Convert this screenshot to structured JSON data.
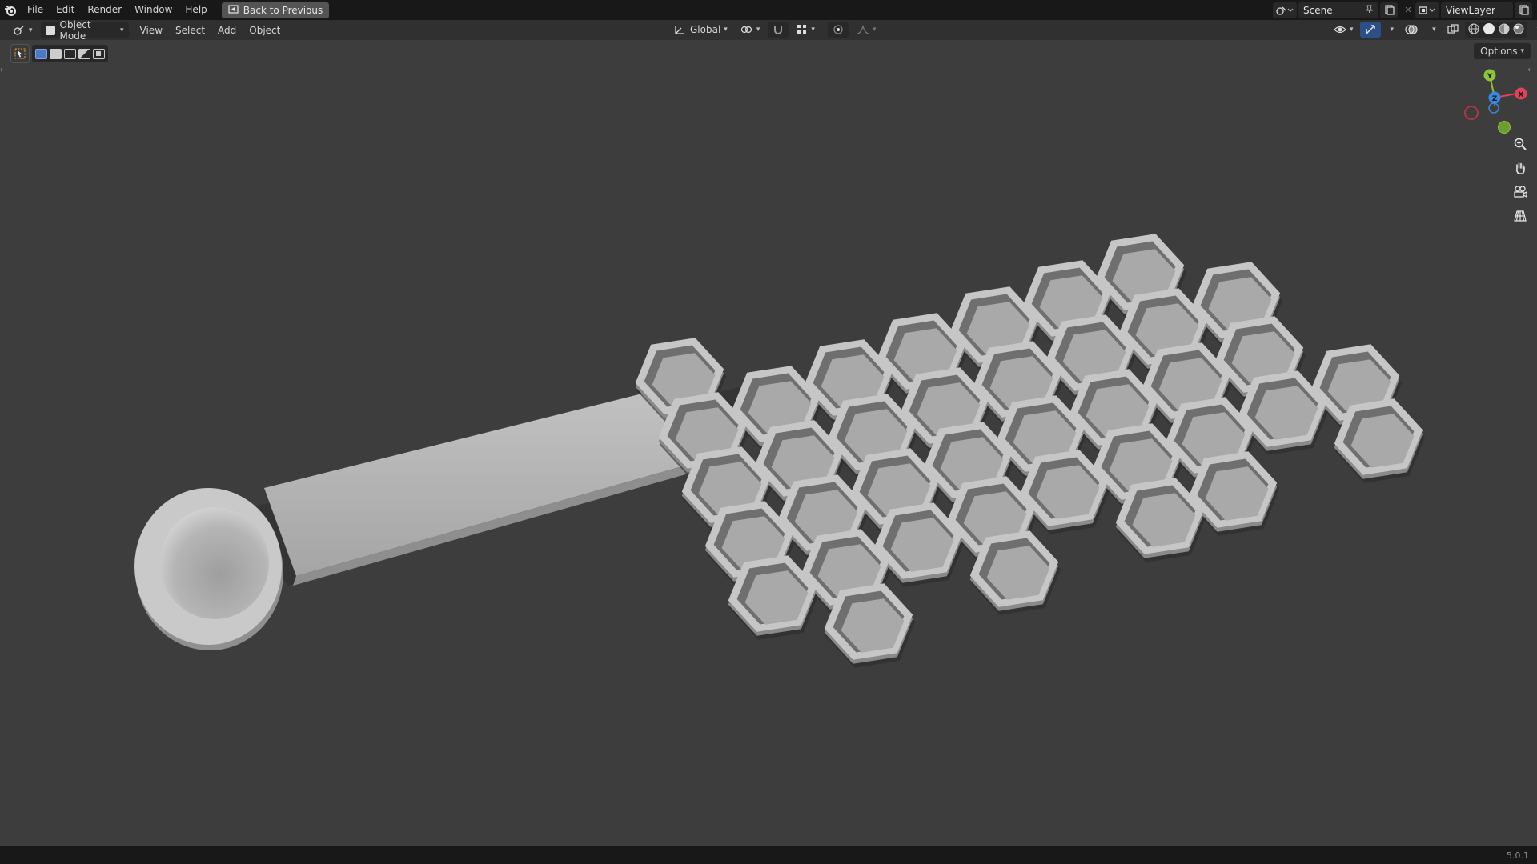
{
  "menu": {
    "items": [
      "File",
      "Edit",
      "Render",
      "Window",
      "Help"
    ],
    "back_button": "Back to Previous"
  },
  "scene": {
    "name": "Scene"
  },
  "view_layer": {
    "name": "ViewLayer"
  },
  "header": {
    "mode": "Object Mode",
    "menus": [
      "View",
      "Select",
      "Add",
      "Object"
    ],
    "transform_orientation": "Global"
  },
  "viewport": {
    "options_label": "Options",
    "gizmo_axes": {
      "x": "X",
      "y": "Y",
      "z": "Z"
    }
  },
  "status": {
    "version": "5.0.1"
  },
  "colors": {
    "background": "#3d3d3d",
    "topbar": "#181818",
    "header": "#303030",
    "accent": "#4d78c4",
    "axis_x": "#e0415b",
    "axis_y": "#8cc43a",
    "axis_z": "#3b86de"
  }
}
